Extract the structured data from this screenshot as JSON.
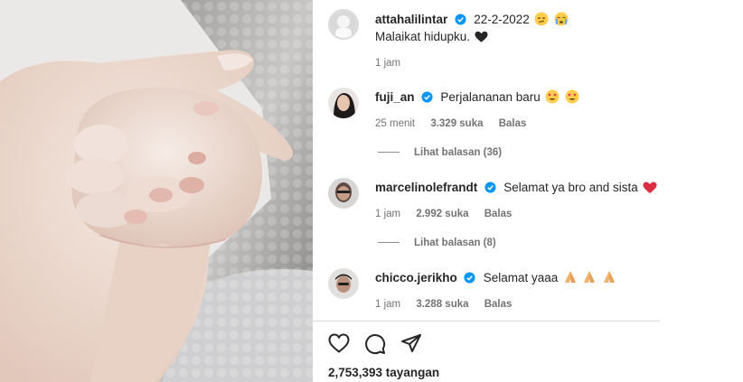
{
  "post": {
    "username": "attahalilintar",
    "date": "22-2-2022",
    "caption": "Malaikat hidupku.",
    "time_ago": "1 jam"
  },
  "comments": [
    {
      "username": "fuji_an",
      "text": "Perjalananan baru",
      "time_ago": "25 menit",
      "likes": "3.329 suka",
      "reply_label": "Balas",
      "view_replies": "Lihat balasan (36)"
    },
    {
      "username": "marcelinolefrandt",
      "text": "Selamat ya bro and sista",
      "time_ago": "1 jam",
      "likes": "2.992 suka",
      "reply_label": "Balas",
      "view_replies": "Lihat balasan (8)"
    },
    {
      "username": "chicco.jerikho",
      "text": "Selamat yaaa",
      "time_ago": "1 jam",
      "likes": "3.288 suka",
      "reply_label": "Balas"
    }
  ],
  "footer": {
    "views": "2,753,393 tayangan"
  },
  "icons": {
    "verified": "verified-badge-icon",
    "like": "heart-icon",
    "comment": "comment-bubble-icon",
    "share": "paper-plane-icon"
  },
  "colors": {
    "verified": "#0095f6",
    "text": "#262626",
    "secondary": "#737373",
    "heart_emoji": "#e0245e"
  }
}
